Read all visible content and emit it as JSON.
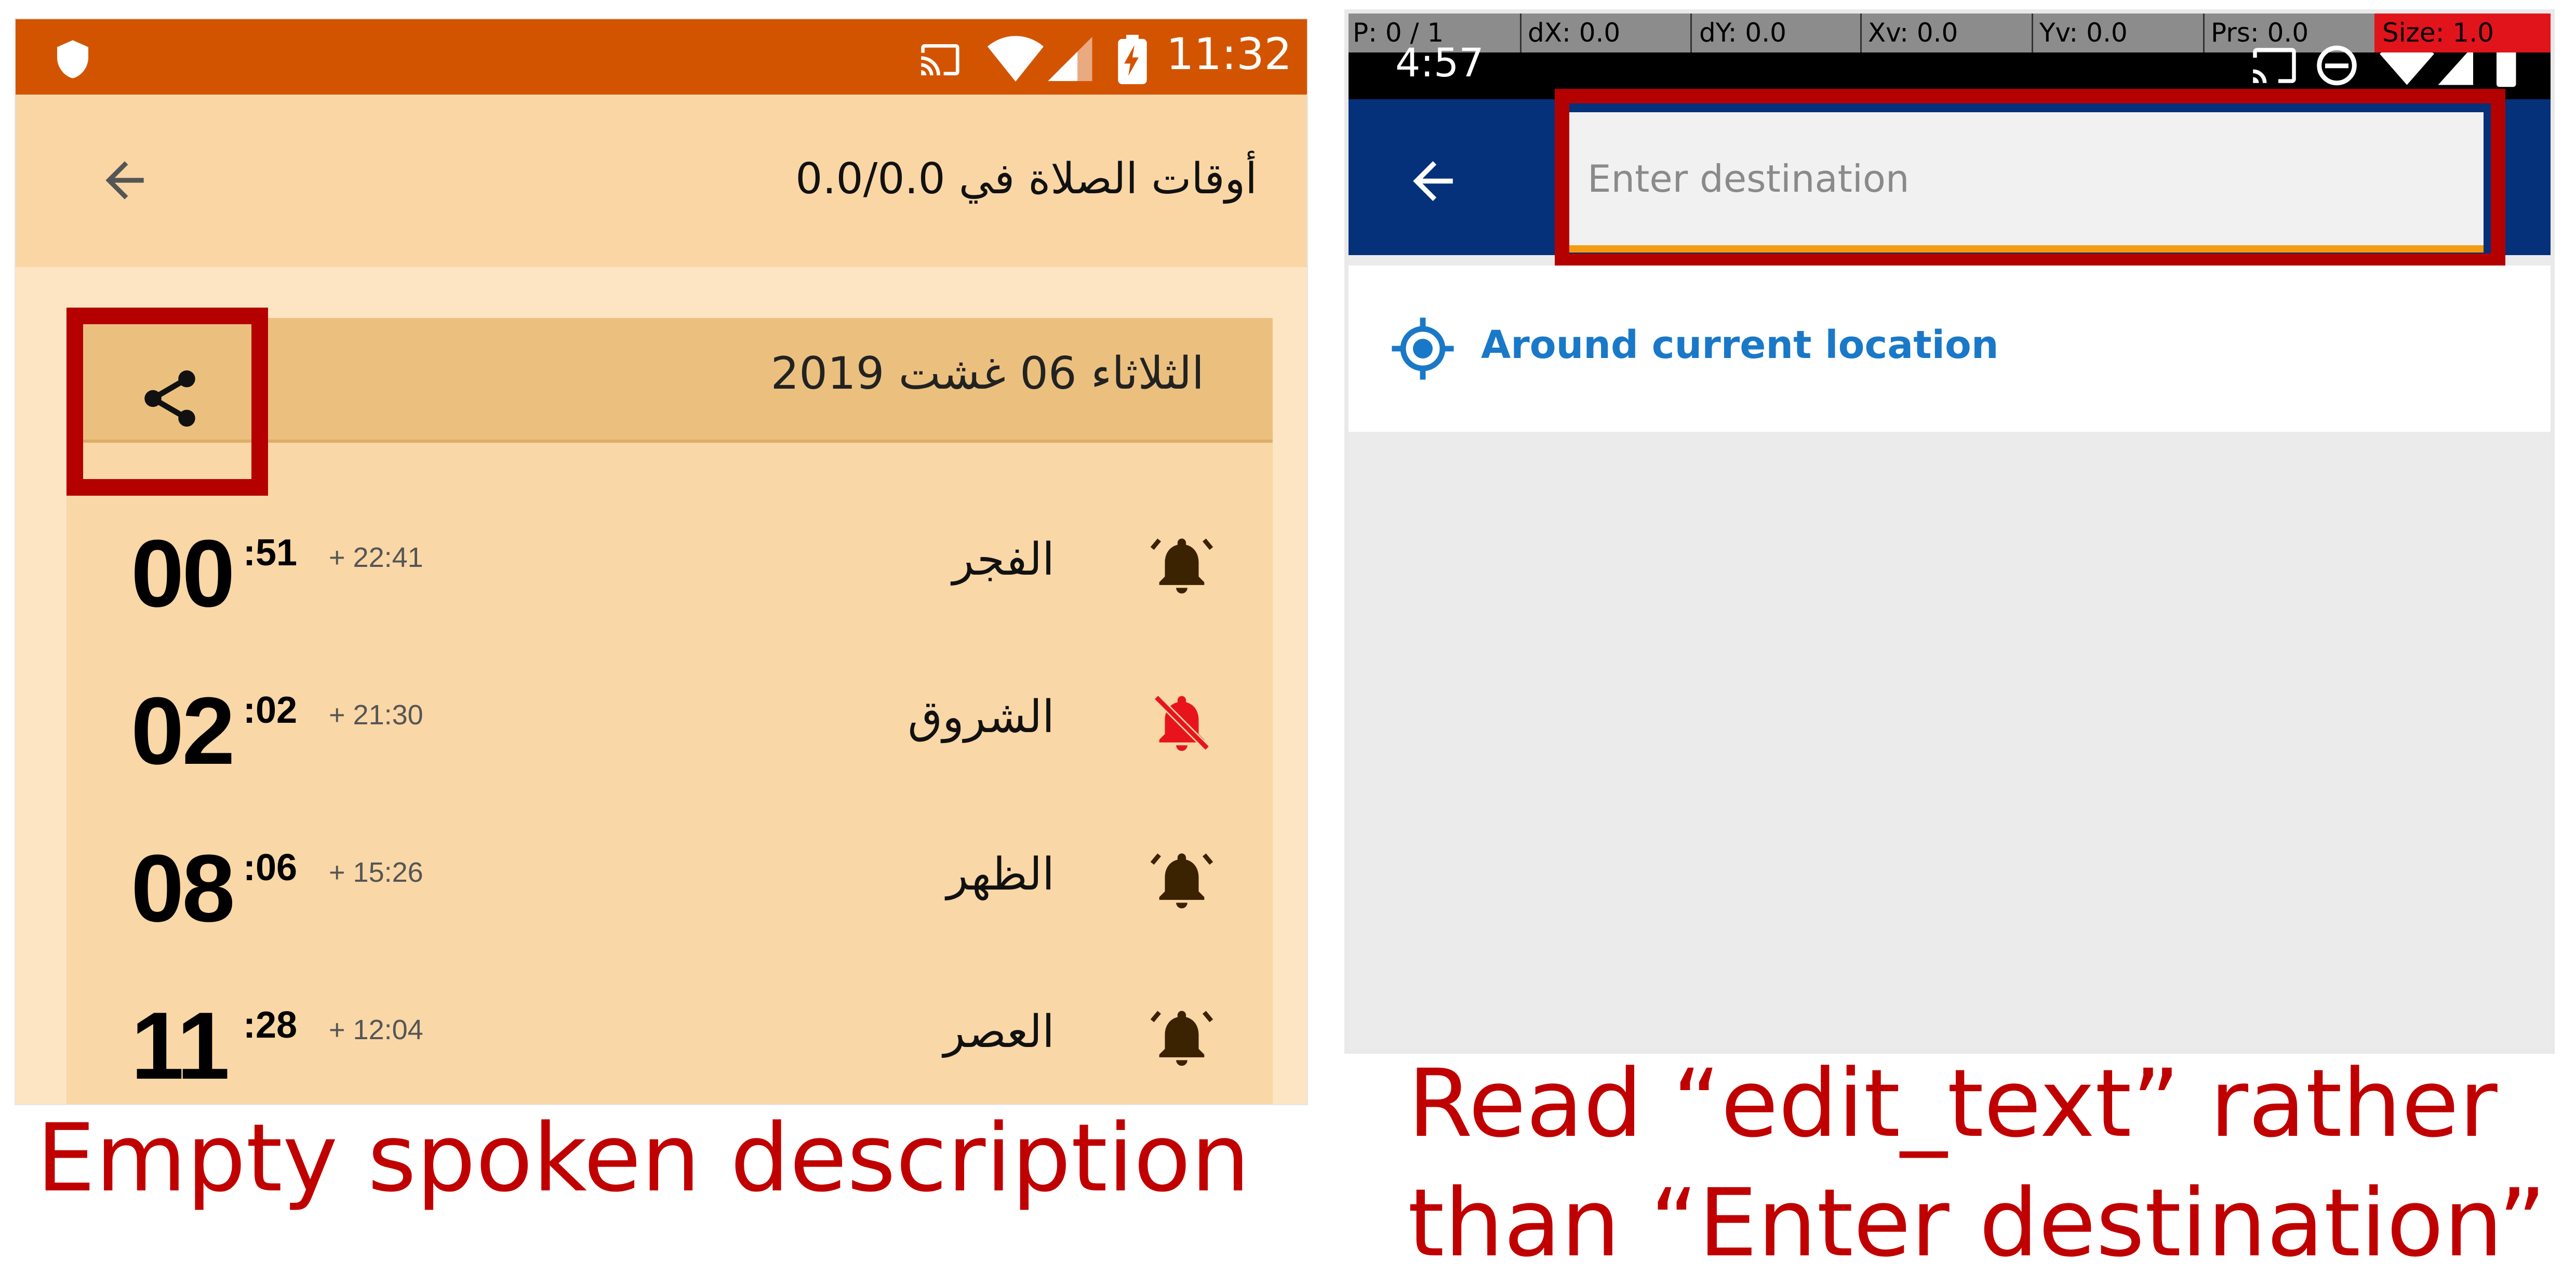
{
  "left": {
    "status_time": "11:32",
    "title": "أوقات الصلاة في 0.0/0.0",
    "date": "الثلاثاء 06 غشت 2019",
    "prayers": [
      {
        "name": "الفجر",
        "hour": "00",
        "minute": ":51",
        "offset": "+ 22:41",
        "bell": "on"
      },
      {
        "name": "الشروق",
        "hour": "02",
        "minute": ":02",
        "offset": "+ 21:30",
        "bell": "off"
      },
      {
        "name": "الظهر",
        "hour": "08",
        "minute": ":06",
        "offset": "+ 15:26",
        "bell": "on"
      },
      {
        "name": "العصر",
        "hour": "11",
        "minute": ":28",
        "offset": "+ 12:04",
        "bell": "on"
      }
    ],
    "colors": {
      "status": "#d35400",
      "appbar": "#fad6a5",
      "highlight": "#b50000",
      "bell_off": "#e8141c"
    },
    "caption": "Empty spoken description"
  },
  "right": {
    "status_time": "4:57",
    "debug": {
      "p": "P: 0 / 1",
      "dx": "dX: 0.0",
      "dy": "dY: 0.0",
      "xv": "Xv: 0.0",
      "yv": "Yv: 0.0",
      "prs": "Prs: 0.0",
      "size": "Size: 1.0"
    },
    "search_placeholder": "Enter destination",
    "location_option": "Around current location",
    "colors": {
      "appbar": "#05307a",
      "accent": "#1a78c8",
      "underline": "#f39c12"
    },
    "caption_line1": "Read “edit_text” rather",
    "caption_line2": "than “Enter destination”"
  },
  "icons": [
    "shield-icon",
    "cast-icon",
    "wifi-icon",
    "signal-icon",
    "battery-icon",
    "back-arrow-icon",
    "share-icon",
    "bell-icon",
    "bell-off-icon",
    "my-location-icon",
    "minus-circle-icon"
  ]
}
